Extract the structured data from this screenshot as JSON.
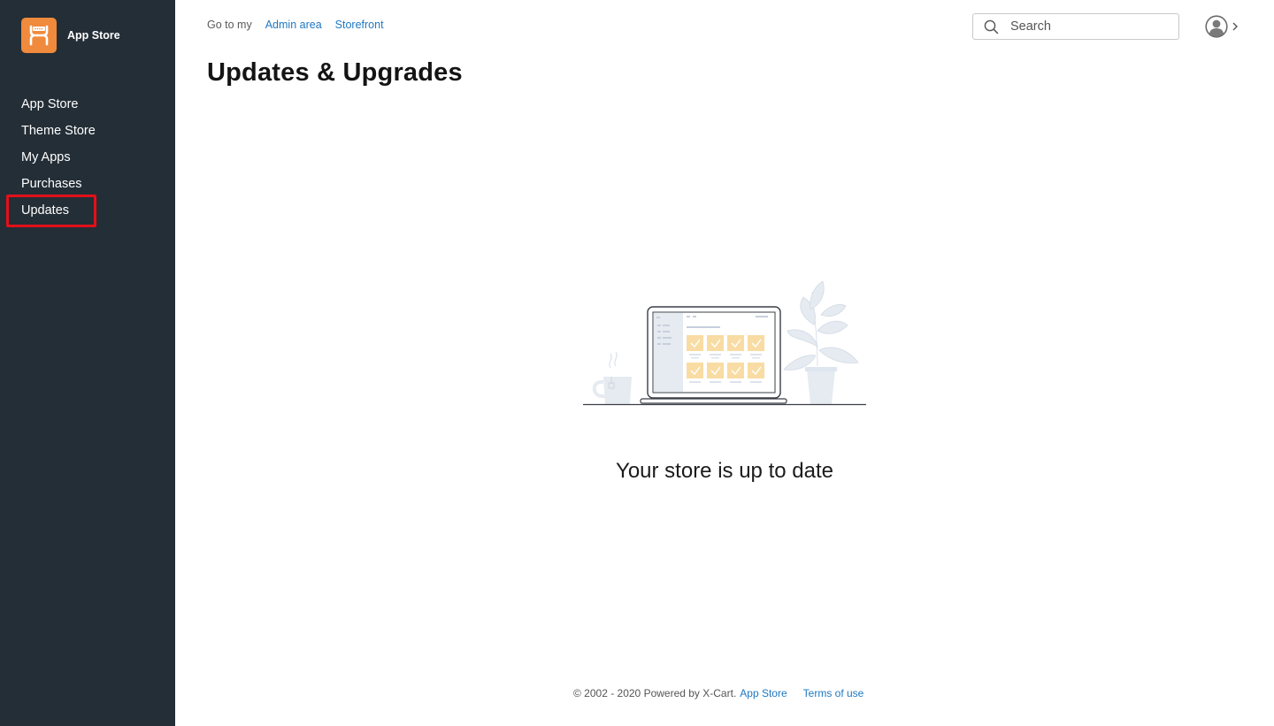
{
  "brand": {
    "name": "App Store",
    "logo_icon": "xcart-logo-icon",
    "logo_color": "#f08a3c"
  },
  "sidebar": {
    "background": "#242e36",
    "items": [
      {
        "label": "App Store"
      },
      {
        "label": "Theme Store"
      },
      {
        "label": "My Apps"
      },
      {
        "label": "Purchases"
      },
      {
        "label": "Updates",
        "highlighted": true
      }
    ]
  },
  "topnav": {
    "label": "Go to my",
    "links": [
      {
        "label": "Admin area"
      },
      {
        "label": "Storefront"
      }
    ],
    "link_color": "#1f78c1"
  },
  "search": {
    "placeholder": "Search",
    "value": ""
  },
  "account": {
    "icon": "user-avatar-icon",
    "chevron": "chevron-right-icon"
  },
  "main": {
    "title": "Updates & Upgrades",
    "status": "Your store is up to date",
    "illustration": "laptop-with-coffee-and-plant-illustration"
  },
  "footer": {
    "copyright": "© 2002 - 2020 Powered by X-Cart.",
    "links": [
      {
        "label": "App Store"
      },
      {
        "label": "Terms of use"
      }
    ]
  },
  "highlight_color": "#e3101a"
}
